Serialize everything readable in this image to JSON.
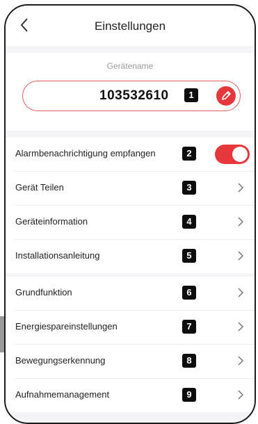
{
  "header": {
    "title": "Einstellungen",
    "back_icon": "chevron-left-icon"
  },
  "device_name": {
    "label": "Gerätename",
    "value": "103532610",
    "badge": "1",
    "edit_icon": "pencil-icon",
    "accent": "#e5373c"
  },
  "section1": {
    "items": [
      {
        "label": "Alarmbenachrichtigung empfangen",
        "badge": "2",
        "type": "toggle",
        "on": true
      },
      {
        "label": "Gerät Teilen",
        "badge": "3"
      },
      {
        "label": "Geräteinformation",
        "badge": "4"
      },
      {
        "label": "Installationsanleitung",
        "badge": "5"
      }
    ]
  },
  "section2": {
    "items": [
      {
        "label": "Grundfunktion",
        "badge": "6"
      },
      {
        "label": "Energiespareinstellungen",
        "badge": "7"
      },
      {
        "label": "Bewegungserkennung",
        "badge": "8"
      },
      {
        "label": "Aufnahmemanagement",
        "badge": "9"
      }
    ]
  }
}
